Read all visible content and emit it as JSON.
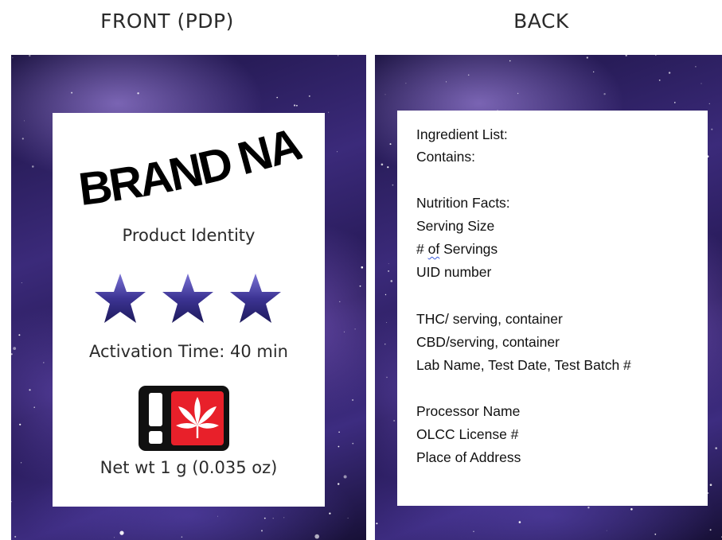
{
  "headings": {
    "front": "FRONT (PDP)",
    "back": "BACK"
  },
  "front": {
    "brand_name": "BRAND NAME",
    "product_identity": "Product Identity",
    "rating_stars": 3,
    "activation_time": "Activation Time: 40 min",
    "warning_icon": "cannabis-warning-icon",
    "net_weight": "Net wt 1 g (0.035 oz)"
  },
  "back": {
    "ingredient_list": "Ingredient List:",
    "contains": "Contains:",
    "nutrition_facts": "Nutrition Facts:",
    "serving_size": "Serving Size",
    "num_servings_prefix": "# ",
    "num_servings_of": "of",
    "num_servings_suffix": " Servings",
    "uid_number": "UID number",
    "thc": "THC/ serving, container",
    "cbd": "CBD/serving, container",
    "lab": "Lab Name, Test Date, Test Batch #",
    "processor_name": "Processor Name",
    "olcc_license": "OLCC License #",
    "place_of_address": "Place of Address"
  },
  "colors": {
    "star_fill": "#3d3494",
    "warning_red": "#e8202a",
    "warning_black": "#111111"
  }
}
